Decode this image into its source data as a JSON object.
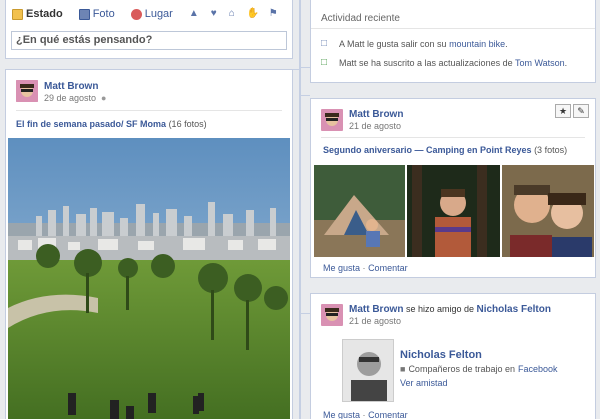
{
  "composer": {
    "tabs": [
      {
        "label": "Estado",
        "icon": "status-icon"
      },
      {
        "label": "Foto",
        "icon": "photo-icon"
      },
      {
        "label": "Lugar",
        "icon": "place-icon"
      }
    ],
    "extra_icons": [
      "event-icon",
      "heart-icon",
      "home-icon",
      "hand-icon",
      "flag-icon"
    ],
    "placeholder": "¿En qué estás pensando?"
  },
  "activity": {
    "title": "Actividad reciente",
    "items": [
      {
        "icon": "like-page-icon",
        "prefix": "A Matt le gusta salir con su ",
        "link": "mountain bike",
        "suffix": "."
      },
      {
        "icon": "subscribe-icon",
        "prefix": "Matt se ha suscrito a las actualizaciones de ",
        "link": "Tom Watson",
        "suffix": "."
      }
    ]
  },
  "post1": {
    "author": "Matt Brown",
    "date": "29 de agosto",
    "album_link": "El fin de semana pasado/ SF Moma",
    "album_count": "(16 fotos)"
  },
  "post2": {
    "author": "Matt Brown",
    "date": "21 de agosto",
    "album_link": "Segundo aniversario — Camping en Point Reyes",
    "album_count": "(3 fotos)",
    "like": "Me gusta",
    "dot": "·",
    "comment": "Comentar"
  },
  "post3": {
    "author": "Matt Brown",
    "action": " se hizo amigo de ",
    "friend": "Nicholas Felton",
    "date": "21 de agosto",
    "friend_name": "Nicholas Felton",
    "work_prefix": "Compañeros de trabajo en ",
    "work_link": "Facebook",
    "view": "Ver amistad",
    "like": "Me gusta",
    "dot": "·",
    "comment": "Comentar"
  },
  "colors": {
    "brand": "#3b5998",
    "border": "#c4cde0",
    "background": "#e9ebee"
  }
}
